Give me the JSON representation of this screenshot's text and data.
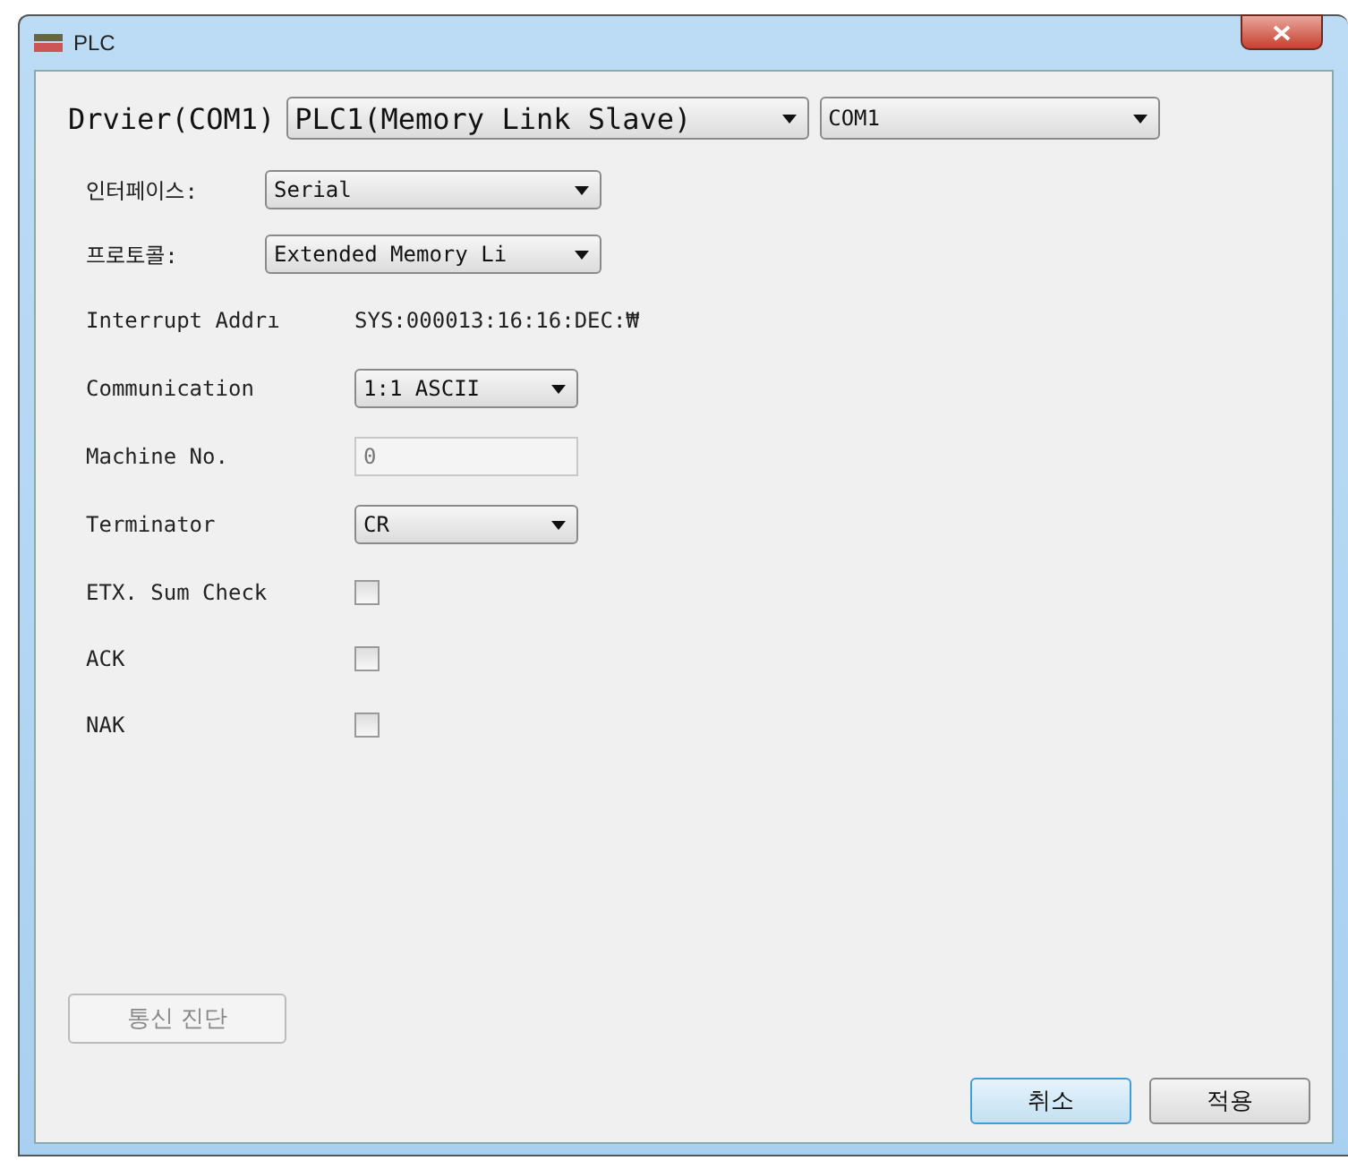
{
  "window": {
    "title": "PLC"
  },
  "driver": {
    "label": "Drvier(COM1)",
    "plc": "PLC1(Memory Link Slave)",
    "port": "COM1"
  },
  "top_fields": [
    {
      "label": "인터페이스:",
      "value": "Serial"
    },
    {
      "label": "프로토콜:",
      "value": "Extended Memory Li"
    }
  ],
  "fields": [
    {
      "kind": "text",
      "label": "Interrupt Addrı",
      "value": "SYS:000013:16:16:DEC:₩"
    },
    {
      "kind": "select",
      "label": "Communication",
      "value": "1:1 ASCII"
    },
    {
      "kind": "input",
      "label": "Machine No.",
      "value": "0",
      "disabled": true
    },
    {
      "kind": "select",
      "label": "Terminator",
      "value": "CR"
    },
    {
      "kind": "checkbox",
      "label": "ETX. Sum Check",
      "checked": false
    },
    {
      "kind": "checkbox",
      "label": "ACK",
      "checked": false
    },
    {
      "kind": "checkbox",
      "label": "NAK",
      "checked": false
    }
  ],
  "diagnose_button": {
    "label": "통신 진단",
    "disabled": true
  },
  "buttons": [
    {
      "label": "취소",
      "selected": true
    },
    {
      "label": "적용",
      "selected": false
    }
  ]
}
